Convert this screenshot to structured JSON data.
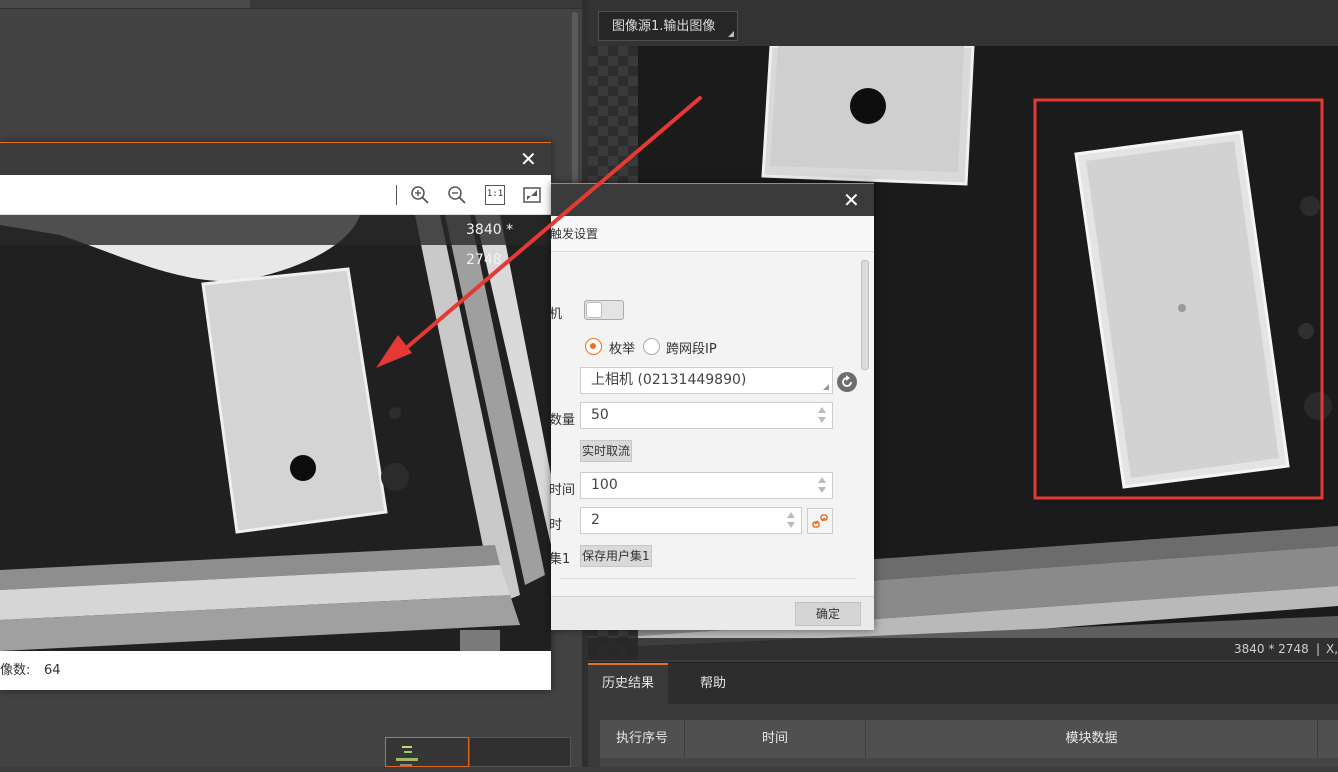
{
  "main_view": {
    "image_source_tab": "图像源1.输出图像",
    "resolution": "3840 * 2748",
    "coord_label": "X,"
  },
  "bottom_panel": {
    "tabs": [
      {
        "label": "历史结果",
        "active": true
      },
      {
        "label": "帮助",
        "active": false
      }
    ],
    "table_headers": [
      "执行序号",
      "时间",
      "模块数据"
    ]
  },
  "viewer": {
    "close_glyph": "✕",
    "resolution": "3840 * 2748",
    "footer_label": "图像数:",
    "footer_value": "64",
    "toolbar_icons": [
      "zoom-in-icon",
      "zoom-out-icon",
      "actual-size-icon",
      "fit-window-icon"
    ],
    "actual_size_label": "1:1"
  },
  "dialog": {
    "close_glyph": "✕",
    "tab_label": "触发设置",
    "rows": {
      "camera_toggle_label": "机",
      "radio_enum_label": "枚举",
      "radio_cross_ip_label": "跨网段IP",
      "camera_select_value": "上相机 (02131449890)",
      "count_label": "数量",
      "count_value": "50",
      "live_button": "实时取流",
      "time_label": "时间",
      "time_value": "100",
      "wait_label": "时",
      "wait_value": "2",
      "userset_label": "集1",
      "save_userset_button": "保存用户集1"
    },
    "ok_button": "确定"
  },
  "colors": {
    "accent": "#e8702a",
    "roi_red": "#e53935",
    "arrow_red": "#e53935"
  }
}
